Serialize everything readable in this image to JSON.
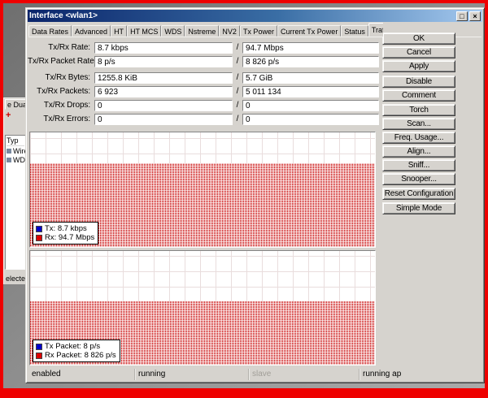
{
  "window": {
    "title": "Interface <wlan1>",
    "icons": {
      "restore": "□",
      "close": "×"
    }
  },
  "tabs": [
    {
      "label": "Data Rates"
    },
    {
      "label": "Advanced"
    },
    {
      "label": "HT"
    },
    {
      "label": "HT MCS"
    },
    {
      "label": "WDS"
    },
    {
      "label": "Nstreme"
    },
    {
      "label": "NV2"
    },
    {
      "label": "Tx Power"
    },
    {
      "label": "Current Tx Power"
    },
    {
      "label": "Status"
    },
    {
      "label": "Traffic"
    },
    {
      "label": "..."
    }
  ],
  "separator": "/",
  "fields": [
    {
      "label": "Tx/Rx Rate:",
      "tx": "8.7 kbps",
      "rx": "94.7 Mbps"
    },
    {
      "label": "Tx/Rx Packet Rate:",
      "tx": "8 p/s",
      "rx": "8 826 p/s"
    },
    {
      "label": "Tx/Rx Bytes:",
      "tx": "1255.8 KiB",
      "rx": "5.7 GiB"
    },
    {
      "label": "Tx/Rx Packets:",
      "tx": "6 923",
      "rx": "5 011 134"
    },
    {
      "label": "Tx/Rx Drops:",
      "tx": "0",
      "rx": "0"
    },
    {
      "label": "Tx/Rx Errors:",
      "tx": "0",
      "rx": "0"
    }
  ],
  "charts": [
    {
      "fill_height": "73%",
      "legend": [
        {
          "label": "Tx: 8.7 kbps",
          "color": "#0000cc"
        },
        {
          "label": "Rx: 94.7 Mbps",
          "color": "#dd0000"
        }
      ]
    },
    {
      "fill_height": "56%",
      "legend": [
        {
          "label": "Tx Packet: 8 p/s",
          "color": "#0000cc"
        },
        {
          "label": "Rx Packet: 8 826 p/s",
          "color": "#dd0000"
        }
      ]
    }
  ],
  "buttons": [
    "OK",
    "Cancel",
    "Apply",
    "Disable",
    "Comment",
    "Torch",
    "Scan...",
    "Freq. Usage...",
    "Align...",
    "Sniff...",
    "Snooper...",
    "Reset Configuration",
    "Simple Mode"
  ],
  "statusbar": [
    "enabled",
    "running",
    "slave",
    "running ap"
  ],
  "background_window": {
    "tab_fragment": "e Dual",
    "toolbar_icon": "+",
    "header_fragment": "Typ",
    "rows": [
      {
        "icon": "interface-icon",
        "label": "Wire"
      },
      {
        "icon": "interface-icon",
        "label": "WD"
      }
    ],
    "footer_fragment": "elected"
  }
}
